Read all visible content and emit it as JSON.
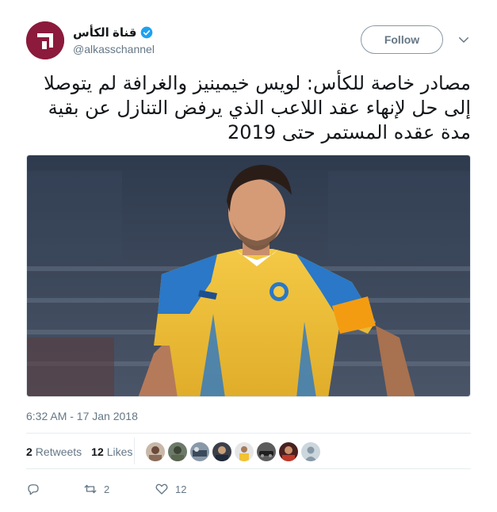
{
  "account": {
    "display_name": "قناة الكأس",
    "handle": "@alkasschannel",
    "verified": true
  },
  "follow_label": "Follow",
  "tweet": {
    "text": "مصادر خاصة للكأس: لويس خيمينيز والغرافة لم يتوصلا إلى حل لإنهاء عقد اللاعب الذي يرفض التنازل عن بقية مدة عقده المستمر حتى 2019",
    "timestamp": "6:32 AM - 17 Jan 2018"
  },
  "stats": {
    "retweets_count": "2",
    "retweets_label": "Retweets",
    "likes_count": "12",
    "likes_label": "Likes"
  },
  "actions": {
    "reply_count": "",
    "retweet_count": "2",
    "like_count": "12"
  },
  "icons": {
    "avatar": "alkass-logo",
    "verified": "verified-badge-icon",
    "caret": "chevron-down-icon",
    "reply": "reply-icon",
    "retweet": "retweet-icon",
    "like": "heart-icon"
  },
  "colors": {
    "brand": "#8b1a3c",
    "verified": "#1da1f2",
    "muted": "#657786",
    "text": "#14171a"
  }
}
